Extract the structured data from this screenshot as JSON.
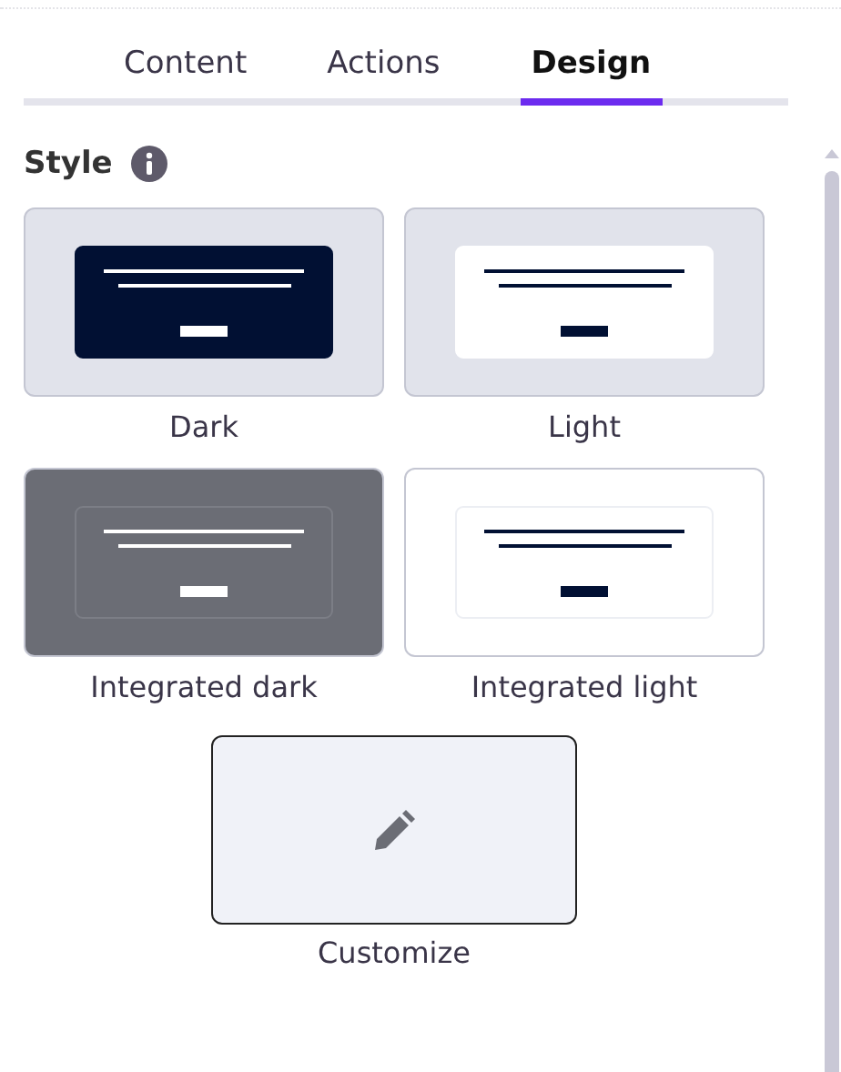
{
  "tabs": [
    {
      "label": "Content",
      "selected": false
    },
    {
      "label": "Actions",
      "selected": false
    },
    {
      "label": "Design",
      "selected": true
    }
  ],
  "section": {
    "title": "Style"
  },
  "styles": [
    {
      "kind": "dark",
      "label": "Dark",
      "selected": false
    },
    {
      "kind": "light",
      "label": "Light",
      "selected": false
    },
    {
      "kind": "integrated_dark",
      "label": "Integrated dark",
      "selected": false
    },
    {
      "kind": "integrated_light",
      "label": "Integrated light",
      "selected": false
    },
    {
      "kind": "customize",
      "label": "Customize",
      "selected": true
    }
  ]
}
